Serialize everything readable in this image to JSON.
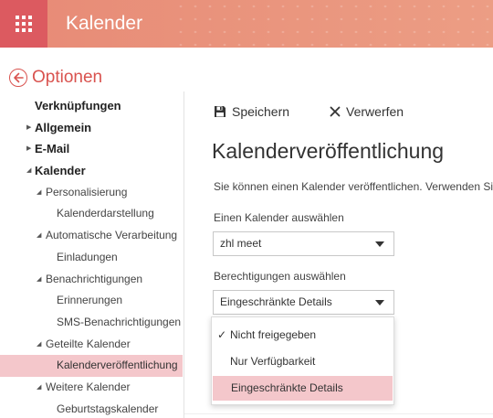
{
  "header": {
    "title": "Kalender",
    "launcher_icon": "waffle-icon",
    "colors": {
      "bar": "#e88a76",
      "launcher": "#dc5a60"
    }
  },
  "back": {
    "label": "Optionen",
    "icon": "back-arrow-icon",
    "color": "#d9534f"
  },
  "nav": {
    "shortcuts": "Verknüpfungen",
    "allgemein": "Allgemein",
    "email": "E-Mail",
    "kalender": "Kalender",
    "personalisierung": "Personalisierung",
    "kalenderdarstellung": "Kalenderdarstellung",
    "automatische": "Automatische Verarbeitung",
    "einladungen": "Einladungen",
    "benachrichtigungen": "Benachrichtigungen",
    "erinnerungen": "Erinnerungen",
    "sms": "SMS-Benachrichtigungen",
    "geteilte": "Geteilte Kalender",
    "veroeffentlichung": "Kalenderveröffentlichung",
    "weitere": "Weitere Kalender",
    "geburtstag": "Geburtstagskalender",
    "selected_color": "#f4c7cb"
  },
  "toolbar": {
    "save_label": "Speichern",
    "discard_label": "Verwerfen"
  },
  "main": {
    "title": "Kalenderveröffentlichung",
    "description": "Sie können einen Kalender veröffentlichen. Verwenden Sie",
    "calendar_label": "Einen Kalender auswählen",
    "calendar_value": "zhl meet",
    "permission_label": "Berechtigungen auswählen",
    "permission_value": "Eingeschränkte Details"
  },
  "dropdown": {
    "options": [
      "Nicht freigegeben",
      "Nur Verfügbarkeit",
      "Eingeschränkte Details"
    ],
    "checked_index": 0,
    "highlighted_index": 2
  }
}
